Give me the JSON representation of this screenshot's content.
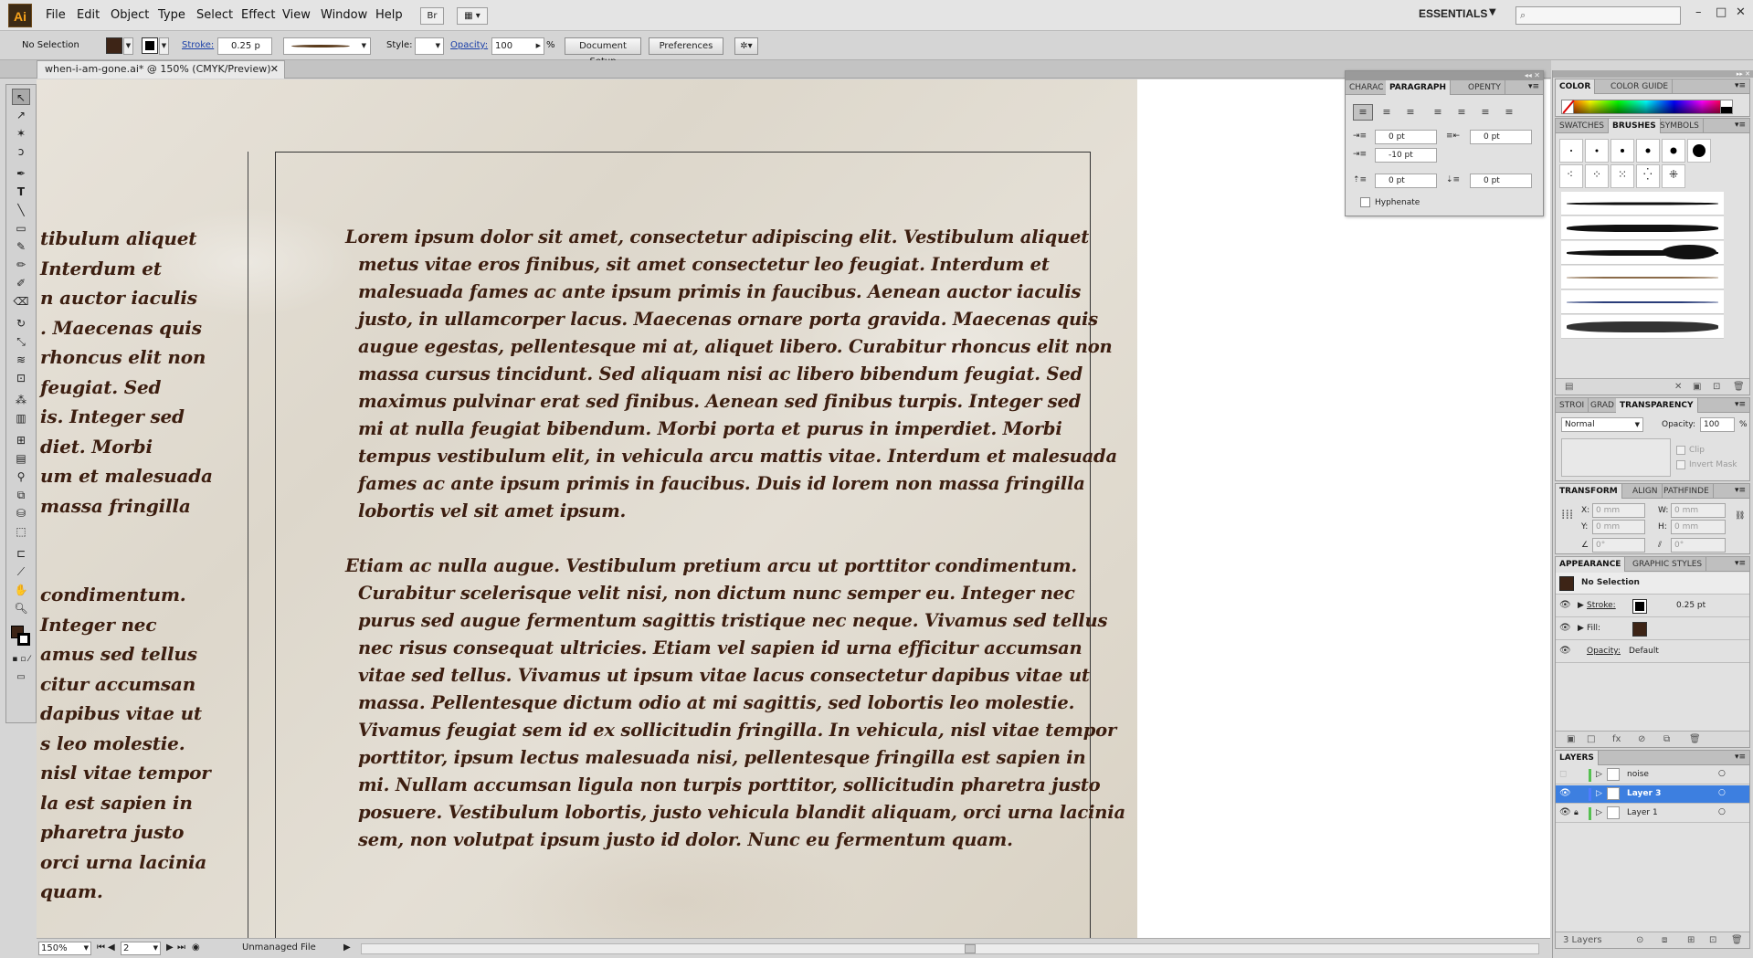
{
  "app": {
    "logo": "Ai"
  },
  "menu": [
    "File",
    "Edit",
    "Object",
    "Type",
    "Select",
    "Effect",
    "View",
    "Window",
    "Help"
  ],
  "menubar": {
    "bridge_btn": "Br",
    "workspace": "ESSENTIALS",
    "window_controls": [
      "–",
      "□",
      "✕"
    ]
  },
  "control": {
    "selection": "No Selection",
    "stroke_label": "Stroke:",
    "stroke_value": "0.25 p",
    "style_label": "Style:",
    "opacity_label": "Opacity:",
    "opacity_value": "100",
    "percent": "%",
    "document_setup": "Document Setup",
    "preferences": "Preferences",
    "fill_color": "#3d2416"
  },
  "document": {
    "tab_title": "when-i-am-gone.ai* @ 150% (CMYK/Preview)",
    "close": "✕"
  },
  "canvas": {
    "left_column": [
      "tibulum aliquet",
      "Interdum et",
      "n auctor iaculis",
      ". Maecenas quis",
      "rhoncus elit non",
      "feugiat. Sed",
      "is. Integer sed",
      "diet. Morbi",
      "um et malesuada",
      "massa fringilla",
      "",
      "",
      "condimentum.",
      "Integer nec",
      "amus sed tellus",
      "citur accumsan",
      "dapibus vitae ut",
      "s leo molestie.",
      "nisl vitae tempor",
      "la est sapien in",
      "pharetra justo",
      "orci urna lacinia",
      "quam."
    ],
    "paragraph1": [
      "Lorem ipsum dolor sit amet, consectetur adipiscing elit. Vestibulum aliquet",
      "metus vitae eros finibus, sit amet consectetur leo feugiat. Interdum et",
      "malesuada fames ac ante ipsum primis in faucibus. Aenean auctor iaculis",
      "justo, in ullamcorper lacus. Maecenas ornare porta gravida. Maecenas quis",
      "augue egestas, pellentesque mi at, aliquet libero. Curabitur rhoncus elit non",
      "massa cursus tincidunt. Sed aliquam nisi ac libero bibendum feugiat. Sed",
      "maximus pulvinar erat sed finibus. Aenean sed finibus turpis. Integer sed",
      "mi at nulla feugiat bibendum. Morbi porta et purus in imperdiet. Morbi",
      "tempus vestibulum elit, in vehicula arcu mattis vitae. Interdum et malesuada",
      "fames ac ante ipsum primis in faucibus. Duis id lorem non massa fringilla",
      "lobortis vel sit amet ipsum."
    ],
    "paragraph2": [
      "Etiam ac nulla augue. Vestibulum pretium arcu ut porttitor condimentum.",
      "Curabitur scelerisque velit nisi, non dictum nunc semper eu. Integer nec",
      "purus sed augue fermentum sagittis tristique nec neque. Vivamus sed tellus",
      "nec risus consequat ultricies. Etiam vel sapien id urna efficitur accumsan",
      "vitae sed tellus. Vivamus ut ipsum vitae lacus consectetur dapibus vitae ut",
      "massa. Pellentesque dictum odio at mi sagittis, sed lobortis leo molestie.",
      "Vivamus feugiat sem id ex sollicitudin fringilla. In vehicula, nisl vitae tempor",
      "porttitor, ipsum lectus malesuada nisi, pellentesque fringilla est sapien in",
      "mi. Nullam accumsan ligula non turpis porttitor, sollicitudin pharetra justo",
      "posuere. Vestibulum lobortis, justo vehicula blandit aliquam, orci urna lacinia",
      "sem, non volutpat ipsum justo id dolor. Nunc eu fermentum quam."
    ]
  },
  "status": {
    "zoom": "150%",
    "page": "2",
    "file_status": "Unmanaged File"
  },
  "paragraph_panel": {
    "tabs": [
      "CHARAC",
      "PARAGRAPH",
      "OPENTY"
    ],
    "indent_left": "0 pt",
    "indent_right": "0 pt",
    "first_line": "-10 pt",
    "space_before": "0 pt",
    "space_after": "0 pt",
    "hyphenate": "Hyphenate"
  },
  "color_panel": {
    "tabs": [
      "COLOR",
      "COLOR GUIDE"
    ]
  },
  "brushes_panel": {
    "tabs": [
      "SWATCHES",
      "BRUSHES",
      "SYMBOLS"
    ]
  },
  "transparency_panel": {
    "tabs": [
      "STROI",
      "GRAD",
      "TRANSPARENCY"
    ],
    "blend_mode": "Normal",
    "opacity_label": "Opacity:",
    "opacity_value": "100",
    "percent": "%",
    "clip": "Clip",
    "invert_mask": "Invert Mask"
  },
  "transform_panel": {
    "tabs": [
      "TRANSFORM",
      "ALIGN",
      "PATHFINDE"
    ],
    "x_label": "X:",
    "y_label": "Y:",
    "w_label": "W:",
    "h_label": "H:",
    "x": "0 mm",
    "y": "0 mm",
    "w": "0 mm",
    "h": "0 mm",
    "angle": "0°",
    "shear": "0°"
  },
  "appearance_panel": {
    "tabs": [
      "APPEARANCE",
      "GRAPHIC STYLES"
    ],
    "title": "No Selection",
    "stroke_label": "Stroke:",
    "stroke_value": "0.25 pt",
    "fill_label": "Fill:",
    "opacity_label": "Opacity:",
    "opacity_value": "Default"
  },
  "layers_panel": {
    "tab": "LAYERS",
    "layers": [
      {
        "name": "noise",
        "color": "#55c050"
      },
      {
        "name": "Layer 3",
        "color": "#4f7cff"
      },
      {
        "name": "Layer 1",
        "color": "#55c050"
      }
    ],
    "count": "3 Layers"
  }
}
